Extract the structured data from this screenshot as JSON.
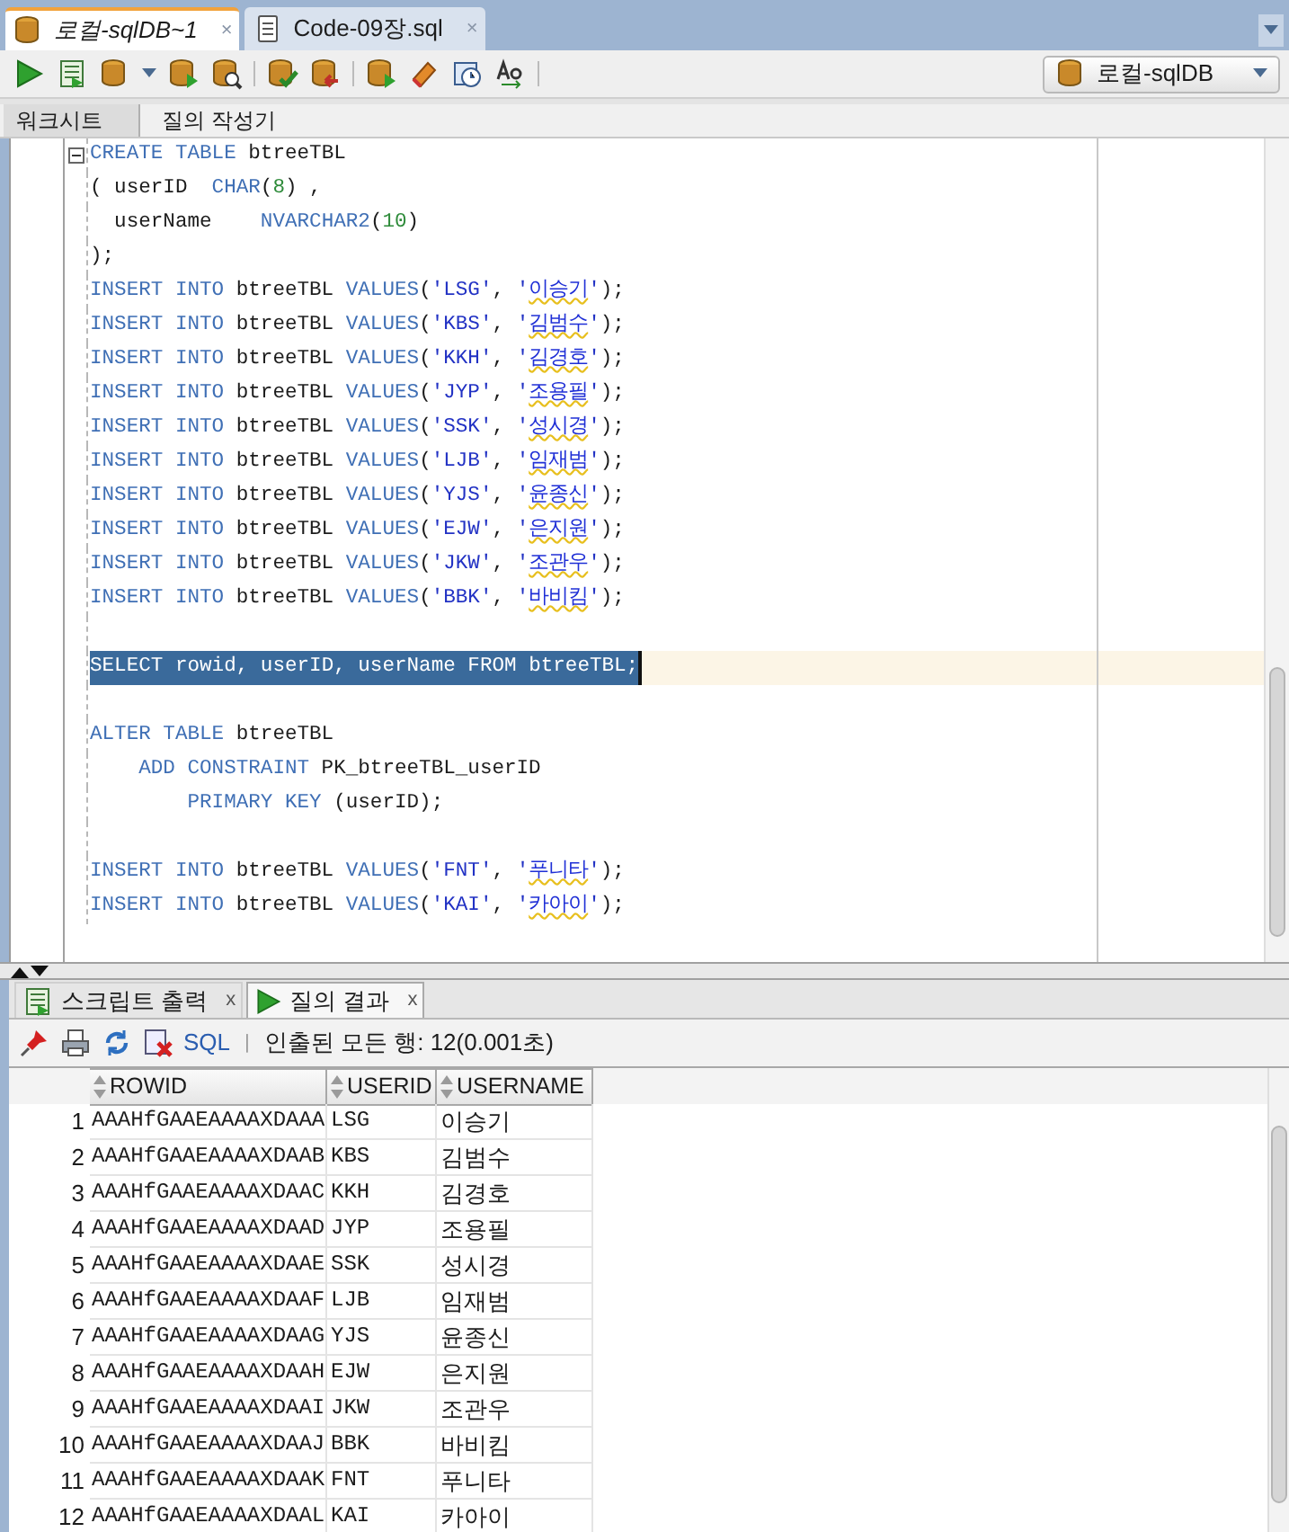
{
  "editor_tabs": [
    {
      "label": "로컬-sqlDB~1",
      "selected": true,
      "close": "×"
    },
    {
      "label": "Code-09장.sql",
      "selected": false,
      "close": "×"
    }
  ],
  "connection": {
    "label": "로컬-sqlDB"
  },
  "worksheet_tabs": [
    {
      "label": "워크시트",
      "selected": true
    },
    {
      "label": "질의 작성기",
      "selected": false
    }
  ],
  "code_lines": [
    {
      "selected": false,
      "fold": true,
      "tokens": [
        {
          "kind": "kw",
          "text": "CREATE TABLE"
        },
        {
          "kind": "id",
          "text": " btreeTBL"
        }
      ]
    },
    {
      "selected": false,
      "fold": false,
      "tokens": [
        {
          "kind": "id",
          "text": "( userID  "
        },
        {
          "kind": "kw",
          "text": "CHAR"
        },
        {
          "kind": "id",
          "text": "("
        },
        {
          "kind": "num",
          "text": "8"
        },
        {
          "kind": "id",
          "text": ") ,"
        }
      ]
    },
    {
      "selected": false,
      "fold": false,
      "tokens": [
        {
          "kind": "id",
          "text": "  userName    "
        },
        {
          "kind": "kw",
          "text": "NVARCHAR2"
        },
        {
          "kind": "id",
          "text": "("
        },
        {
          "kind": "num",
          "text": "10"
        },
        {
          "kind": "id",
          "text": ")"
        }
      ]
    },
    {
      "selected": false,
      "fold": false,
      "tokens": [
        {
          "kind": "id",
          "text": ");"
        }
      ]
    },
    {
      "selected": false,
      "fold": false,
      "tokens": [
        {
          "kind": "kw",
          "text": "INSERT INTO"
        },
        {
          "kind": "id",
          "text": " btreeTBL "
        },
        {
          "kind": "kw",
          "text": "VALUES"
        },
        {
          "kind": "id",
          "text": "("
        },
        {
          "kind": "str",
          "text": "'LSG'"
        },
        {
          "kind": "id",
          "text": ", "
        },
        {
          "kind": "str",
          "text": "'"
        },
        {
          "kind": "flag",
          "text": "이승기"
        },
        {
          "kind": "str",
          "text": "'"
        },
        {
          "kind": "id",
          "text": ");"
        }
      ]
    },
    {
      "selected": false,
      "fold": false,
      "tokens": [
        {
          "kind": "kw",
          "text": "INSERT INTO"
        },
        {
          "kind": "id",
          "text": " btreeTBL "
        },
        {
          "kind": "kw",
          "text": "VALUES"
        },
        {
          "kind": "id",
          "text": "("
        },
        {
          "kind": "str",
          "text": "'KBS'"
        },
        {
          "kind": "id",
          "text": ", "
        },
        {
          "kind": "str",
          "text": "'"
        },
        {
          "kind": "flag",
          "text": "김범수"
        },
        {
          "kind": "str",
          "text": "'"
        },
        {
          "kind": "id",
          "text": ");"
        }
      ]
    },
    {
      "selected": false,
      "fold": false,
      "tokens": [
        {
          "kind": "kw",
          "text": "INSERT INTO"
        },
        {
          "kind": "id",
          "text": " btreeTBL "
        },
        {
          "kind": "kw",
          "text": "VALUES"
        },
        {
          "kind": "id",
          "text": "("
        },
        {
          "kind": "str",
          "text": "'KKH'"
        },
        {
          "kind": "id",
          "text": ", "
        },
        {
          "kind": "str",
          "text": "'"
        },
        {
          "kind": "flag",
          "text": "김경호"
        },
        {
          "kind": "str",
          "text": "'"
        },
        {
          "kind": "id",
          "text": ");"
        }
      ]
    },
    {
      "selected": false,
      "fold": false,
      "tokens": [
        {
          "kind": "kw",
          "text": "INSERT INTO"
        },
        {
          "kind": "id",
          "text": " btreeTBL "
        },
        {
          "kind": "kw",
          "text": "VALUES"
        },
        {
          "kind": "id",
          "text": "("
        },
        {
          "kind": "str",
          "text": "'JYP'"
        },
        {
          "kind": "id",
          "text": ", "
        },
        {
          "kind": "str",
          "text": "'"
        },
        {
          "kind": "flag",
          "text": "조용필"
        },
        {
          "kind": "str",
          "text": "'"
        },
        {
          "kind": "id",
          "text": ");"
        }
      ]
    },
    {
      "selected": false,
      "fold": false,
      "tokens": [
        {
          "kind": "kw",
          "text": "INSERT INTO"
        },
        {
          "kind": "id",
          "text": " btreeTBL "
        },
        {
          "kind": "kw",
          "text": "VALUES"
        },
        {
          "kind": "id",
          "text": "("
        },
        {
          "kind": "str",
          "text": "'SSK'"
        },
        {
          "kind": "id",
          "text": ", "
        },
        {
          "kind": "str",
          "text": "'"
        },
        {
          "kind": "flag",
          "text": "성시경"
        },
        {
          "kind": "str",
          "text": "'"
        },
        {
          "kind": "id",
          "text": ");"
        }
      ]
    },
    {
      "selected": false,
      "fold": false,
      "tokens": [
        {
          "kind": "kw",
          "text": "INSERT INTO"
        },
        {
          "kind": "id",
          "text": " btreeTBL "
        },
        {
          "kind": "kw",
          "text": "VALUES"
        },
        {
          "kind": "id",
          "text": "("
        },
        {
          "kind": "str",
          "text": "'LJB'"
        },
        {
          "kind": "id",
          "text": ", "
        },
        {
          "kind": "str",
          "text": "'"
        },
        {
          "kind": "flag",
          "text": "임재범"
        },
        {
          "kind": "str",
          "text": "'"
        },
        {
          "kind": "id",
          "text": ");"
        }
      ]
    },
    {
      "selected": false,
      "fold": false,
      "tokens": [
        {
          "kind": "kw",
          "text": "INSERT INTO"
        },
        {
          "kind": "id",
          "text": " btreeTBL "
        },
        {
          "kind": "kw",
          "text": "VALUES"
        },
        {
          "kind": "id",
          "text": "("
        },
        {
          "kind": "str",
          "text": "'YJS'"
        },
        {
          "kind": "id",
          "text": ", "
        },
        {
          "kind": "str",
          "text": "'"
        },
        {
          "kind": "flag",
          "text": "윤종신"
        },
        {
          "kind": "str",
          "text": "'"
        },
        {
          "kind": "id",
          "text": ");"
        }
      ]
    },
    {
      "selected": false,
      "fold": false,
      "tokens": [
        {
          "kind": "kw",
          "text": "INSERT INTO"
        },
        {
          "kind": "id",
          "text": " btreeTBL "
        },
        {
          "kind": "kw",
          "text": "VALUES"
        },
        {
          "kind": "id",
          "text": "("
        },
        {
          "kind": "str",
          "text": "'EJW'"
        },
        {
          "kind": "id",
          "text": ", "
        },
        {
          "kind": "str",
          "text": "'"
        },
        {
          "kind": "flag",
          "text": "은지원"
        },
        {
          "kind": "str",
          "text": "'"
        },
        {
          "kind": "id",
          "text": ");"
        }
      ]
    },
    {
      "selected": false,
      "fold": false,
      "tokens": [
        {
          "kind": "kw",
          "text": "INSERT INTO"
        },
        {
          "kind": "id",
          "text": " btreeTBL "
        },
        {
          "kind": "kw",
          "text": "VALUES"
        },
        {
          "kind": "id",
          "text": "("
        },
        {
          "kind": "str",
          "text": "'JKW'"
        },
        {
          "kind": "id",
          "text": ", "
        },
        {
          "kind": "str",
          "text": "'"
        },
        {
          "kind": "flag",
          "text": "조관우"
        },
        {
          "kind": "str",
          "text": "'"
        },
        {
          "kind": "id",
          "text": ");"
        }
      ]
    },
    {
      "selected": false,
      "fold": false,
      "tokens": [
        {
          "kind": "kw",
          "text": "INSERT INTO"
        },
        {
          "kind": "id",
          "text": " btreeTBL "
        },
        {
          "kind": "kw",
          "text": "VALUES"
        },
        {
          "kind": "id",
          "text": "("
        },
        {
          "kind": "str",
          "text": "'BBK'"
        },
        {
          "kind": "id",
          "text": ", "
        },
        {
          "kind": "str",
          "text": "'"
        },
        {
          "kind": "flag",
          "text": "바비킴"
        },
        {
          "kind": "str",
          "text": "'"
        },
        {
          "kind": "id",
          "text": ");"
        }
      ]
    },
    {
      "selected": false,
      "fold": false
    },
    {
      "selected": true,
      "fold": false,
      "tokens": [
        {
          "kind": "kw",
          "text": "SELECT"
        },
        {
          "kind": "id",
          "text": " rowid, userID, userName "
        },
        {
          "kind": "kw",
          "text": "FROM"
        },
        {
          "kind": "id",
          "text": " btreeTBL;"
        }
      ]
    },
    {
      "selected": false,
      "fold": false
    },
    {
      "selected": false,
      "fold": false,
      "tokens": [
        {
          "kind": "kw",
          "text": "ALTER TABLE"
        },
        {
          "kind": "id",
          "text": " btreeTBL"
        }
      ]
    },
    {
      "selected": false,
      "fold": false,
      "tokens": [
        {
          "kind": "kw",
          "text": "    ADD CONSTRAINT"
        },
        {
          "kind": "id",
          "text": " PK_btreeTBL_userID"
        }
      ]
    },
    {
      "selected": false,
      "fold": false,
      "tokens": [
        {
          "kind": "kw",
          "text": "        PRIMARY KEY"
        },
        {
          "kind": "id",
          "text": " (userID);"
        }
      ]
    },
    {
      "selected": false,
      "fold": false
    },
    {
      "selected": false,
      "fold": false,
      "tokens": [
        {
          "kind": "kw",
          "text": "INSERT INTO"
        },
        {
          "kind": "id",
          "text": " btreeTBL "
        },
        {
          "kind": "kw",
          "text": "VALUES"
        },
        {
          "kind": "id",
          "text": "("
        },
        {
          "kind": "str",
          "text": "'FNT'"
        },
        {
          "kind": "id",
          "text": ", "
        },
        {
          "kind": "str",
          "text": "'"
        },
        {
          "kind": "flag",
          "text": "푸니타"
        },
        {
          "kind": "str",
          "text": "'"
        },
        {
          "kind": "id",
          "text": ");"
        }
      ]
    },
    {
      "selected": false,
      "fold": false,
      "tokens": [
        {
          "kind": "kw",
          "text": "INSERT INTO"
        },
        {
          "kind": "id",
          "text": " btreeTBL "
        },
        {
          "kind": "kw",
          "text": "VALUES"
        },
        {
          "kind": "id",
          "text": "("
        },
        {
          "kind": "str",
          "text": "'KAI'"
        },
        {
          "kind": "id",
          "text": ", "
        },
        {
          "kind": "str",
          "text": "'"
        },
        {
          "kind": "flag",
          "text": "카아이"
        },
        {
          "kind": "str",
          "text": "'"
        },
        {
          "kind": "id",
          "text": ");"
        }
      ]
    }
  ],
  "result_tabs": [
    {
      "label": "스크립트 출력",
      "selected": false,
      "close": "x"
    },
    {
      "label": "질의 결과",
      "selected": true,
      "close": "x"
    }
  ],
  "result_toolbar": {
    "sql_link": "SQL",
    "separator": "|",
    "status": "인출된 모든 행: 12(0.001초)"
  },
  "table": {
    "columns": [
      "ROWID",
      "USERID",
      "USERNAME"
    ],
    "rows": [
      {
        "num": "1",
        "rowid": "AAAHfGAAEAAAAXDAAA",
        "userid": "LSG",
        "username": "이승기"
      },
      {
        "num": "2",
        "rowid": "AAAHfGAAEAAAAXDAAB",
        "userid": "KBS",
        "username": "김범수"
      },
      {
        "num": "3",
        "rowid": "AAAHfGAAEAAAAXDAAC",
        "userid": "KKH",
        "username": "김경호"
      },
      {
        "num": "4",
        "rowid": "AAAHfGAAEAAAAXDAAD",
        "userid": "JYP",
        "username": "조용필"
      },
      {
        "num": "5",
        "rowid": "AAAHfGAAEAAAAXDAAE",
        "userid": "SSK",
        "username": "성시경"
      },
      {
        "num": "6",
        "rowid": "AAAHfGAAEAAAAXDAAF",
        "userid": "LJB",
        "username": "임재범"
      },
      {
        "num": "7",
        "rowid": "AAAHfGAAEAAAAXDAAG",
        "userid": "YJS",
        "username": "윤종신"
      },
      {
        "num": "8",
        "rowid": "AAAHfGAAEAAAAXDAAH",
        "userid": "EJW",
        "username": "은지원"
      },
      {
        "num": "9",
        "rowid": "AAAHfGAAEAAAAXDAAI",
        "userid": "JKW",
        "username": "조관우"
      },
      {
        "num": "10",
        "rowid": "AAAHfGAAEAAAAXDAAJ",
        "userid": "BBK",
        "username": "바비킴"
      },
      {
        "num": "11",
        "rowid": "AAAHfGAAEAAAAXDAAK",
        "userid": "FNT",
        "username": "푸니타"
      },
      {
        "num": "12",
        "rowid": "AAAHfGAAEAAAAXDAAL",
        "userid": "KAI",
        "username": "카아이"
      }
    ]
  }
}
